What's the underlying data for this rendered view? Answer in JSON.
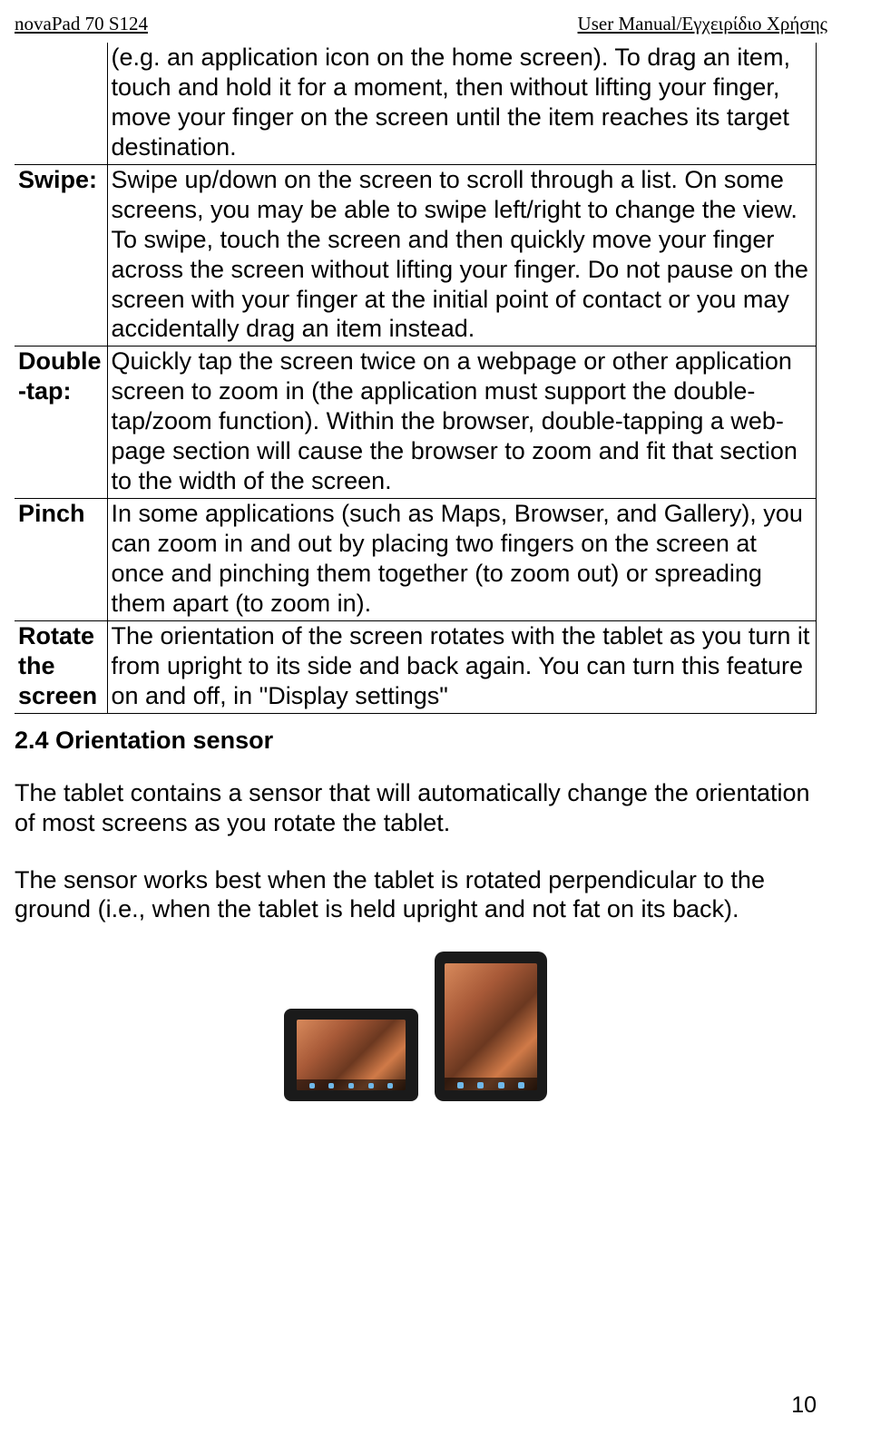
{
  "header": {
    "left": "novaPad 70 S124",
    "right": "User Manual/Εγχειρίδιο Χρήσης"
  },
  "table": {
    "rows": [
      {
        "label": "",
        "desc": "(e.g. an application icon on the home screen). To drag an item, touch and hold it for a moment, then without lifting your finger, move your finger on the screen until the item reaches its target destination."
      },
      {
        "label": "Swipe:",
        "desc": "Swipe up/down on the screen to scroll through a list. On some screens, you may be able to swipe left/right to change the view.\nTo swipe, touch the screen and then quickly move your finger across the screen without lifting your finger. Do not pause on the screen with your finger at the initial point of contact or you may accidentally drag an item instead."
      },
      {
        "label": "Double-tap:",
        "desc": "Quickly tap the screen twice on a webpage or other application screen to zoom in (the application must support the double-tap/zoom function). Within the browser, double-tapping a web-page section will cause the browser to zoom and fit that section to the width of the screen."
      },
      {
        "label": "Pinch",
        "desc": "In some applications (such as Maps, Browser, and Gallery), you can zoom in and out by placing two fingers on the screen at once and pinching them together (to zoom out) or spreading them apart (to zoom in)."
      },
      {
        "label": "Rotate the screen",
        "desc": "The orientation of the screen rotates with the tablet as you turn it from upright to its side and back again. You can turn this feature on and off, in \"Display settings\""
      }
    ]
  },
  "section_heading": "2.4 Orientation sensor",
  "para1": "The tablet contains a sensor that will automatically change the orientation of most screens as you rotate the tablet.",
  "para2": "The sensor works best when the tablet is rotated perpendicular to the ground (i.e., when the tablet is held upright and not fat on its back).",
  "page_number": "10"
}
